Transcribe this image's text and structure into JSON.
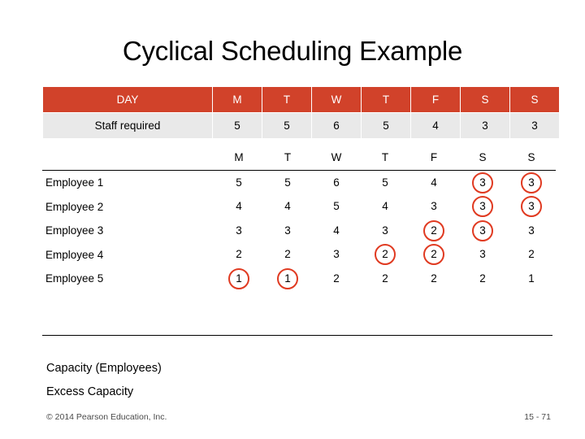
{
  "slide": {
    "title": "Cyclical Scheduling Example",
    "copyright": "© 2014 Pearson Education, Inc.",
    "page_number": "15 - 71",
    "capacity_label": "Capacity (Employees)",
    "excess_label": "Excess Capacity"
  },
  "requirements_table": {
    "header": [
      "DAY",
      "M",
      "T",
      "W",
      "T",
      "F",
      "S",
      "S"
    ],
    "row_label": "Staff required",
    "values": [
      5,
      5,
      6,
      5,
      4,
      3,
      3
    ],
    "header_bg": "#d1422a",
    "header_color": "#ffffff",
    "row_bg": "#e9e9e9"
  },
  "schedule_grid": {
    "day_header": [
      "M",
      "T",
      "W",
      "T",
      "F",
      "S",
      "S"
    ],
    "circle_color": "#e03a21",
    "rows": [
      {
        "name": "Employee 1",
        "values": [
          5,
          5,
          6,
          5,
          4,
          3,
          3
        ],
        "circled": [
          false,
          false,
          false,
          false,
          false,
          true,
          true
        ]
      },
      {
        "name": "Employee 2",
        "values": [
          4,
          4,
          5,
          4,
          3,
          3,
          3
        ],
        "circled": [
          false,
          false,
          false,
          false,
          false,
          true,
          true
        ]
      },
      {
        "name": "Employee 3",
        "values": [
          3,
          3,
          4,
          3,
          2,
          3,
          3
        ],
        "circled": [
          false,
          false,
          false,
          false,
          true,
          true,
          false
        ]
      },
      {
        "name": "Employee 4",
        "values": [
          2,
          2,
          3,
          2,
          2,
          3,
          2
        ],
        "circled": [
          false,
          false,
          false,
          true,
          true,
          false,
          false
        ]
      },
      {
        "name": "Employee 5",
        "values": [
          1,
          1,
          2,
          2,
          2,
          2,
          1
        ],
        "circled": [
          true,
          true,
          false,
          false,
          false,
          false,
          false
        ]
      }
    ]
  }
}
